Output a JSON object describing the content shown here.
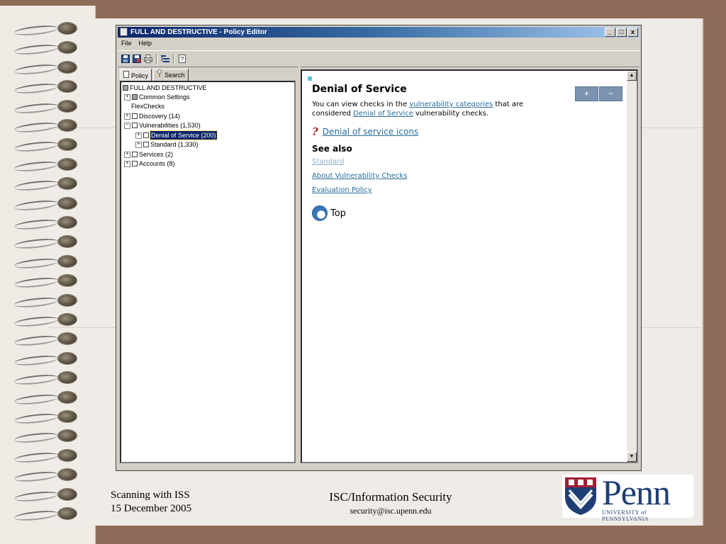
{
  "window": {
    "title": "FULL AND DESTRUCTIVE - Policy Editor",
    "controls": [
      "_",
      "□",
      "x"
    ]
  },
  "menu": {
    "file": "File",
    "help": "Help"
  },
  "toolbar_icons": [
    "save-icon",
    "save-all-icon",
    "print-icon",
    "tree-icon",
    "help-icon"
  ],
  "tabs": {
    "policy": "Policy",
    "search": "Search"
  },
  "tree": {
    "root": "FULL AND DESTRUCTIVE",
    "items": [
      {
        "label": "Common Settings"
      },
      {
        "label": "FlexChecks"
      },
      {
        "label": "Discovery (14)"
      },
      {
        "label": "Vulnerabilities (1,530)"
      },
      {
        "label": "Denial of Service (200)"
      },
      {
        "label": "Standard (1,330)"
      },
      {
        "label": "Services (2)"
      },
      {
        "label": "Accounts (8)"
      }
    ]
  },
  "content": {
    "heading": "Denial of Service",
    "para_1": "You can view checks in the ",
    "link_categories": "vulnerability categories",
    "para_2": " that are",
    "para_3": "considered ",
    "link_dos": "Denial of Service",
    "para_4": " vulnerability checks.",
    "icons_link": "Denial of service icons",
    "see_also": "See also",
    "see_also_links": [
      "Standard",
      "About Vulnerability Checks",
      "Evaluation Policy"
    ],
    "top": "Top",
    "zoom_in": "+",
    "zoom_out": "−"
  },
  "footer": {
    "left_line1": "Scanning with ISS",
    "left_line2": "15 December 2005",
    "center_title": "ISC/Information Security",
    "center_email": "security@isc.upenn.edu",
    "logo_word": "Penn",
    "logo_sub": "UNIVERSITY of PENNSYLVANIA"
  },
  "colors": {
    "titlebar": "#0a246a",
    "link": "#2a6c98",
    "selection": "#0a246a",
    "penn_blue": "#1f3e74",
    "background": "#8d6b58"
  }
}
